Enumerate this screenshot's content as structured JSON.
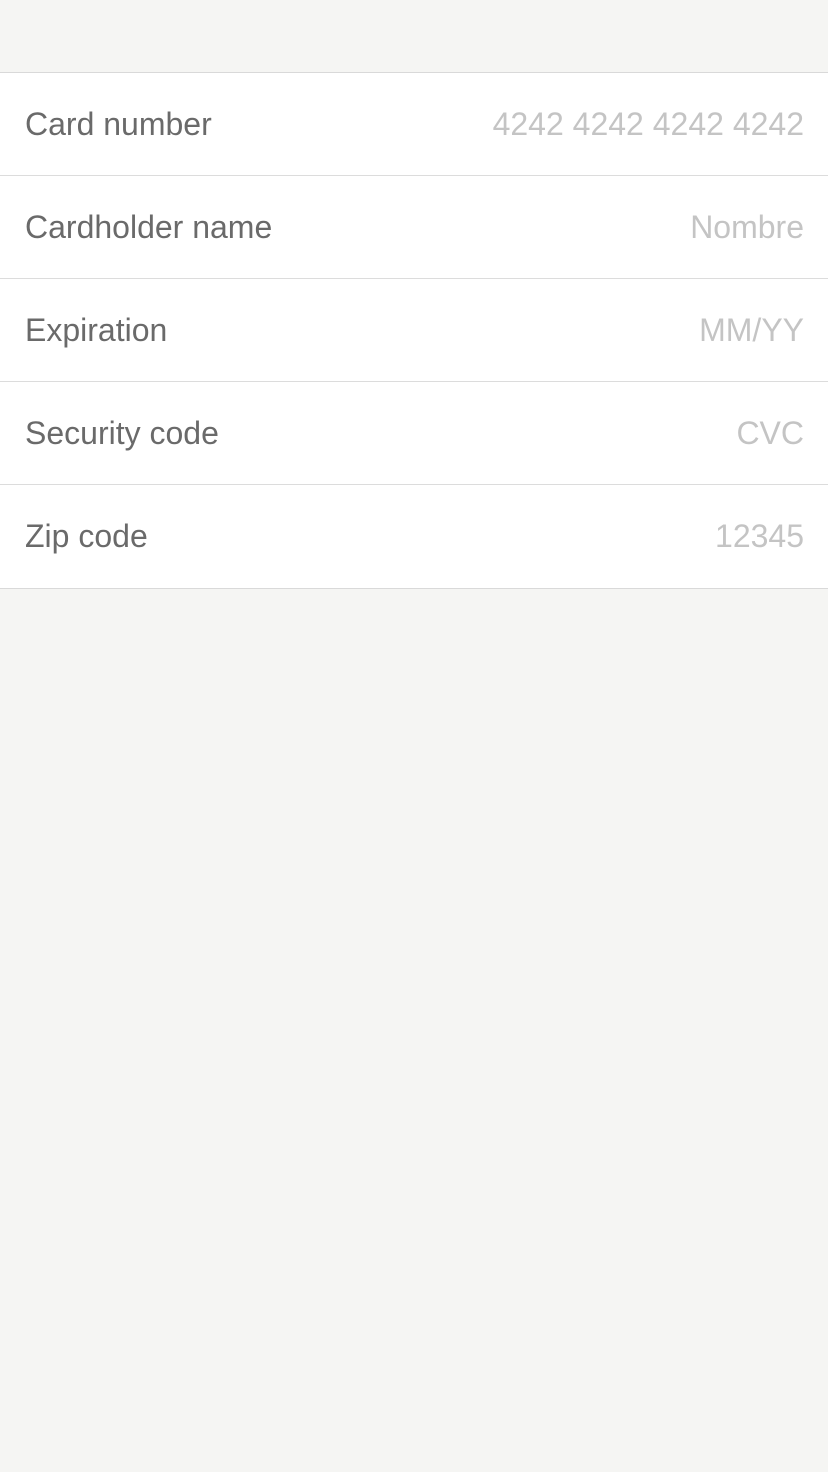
{
  "form": {
    "fields": [
      {
        "label": "Card number",
        "placeholder": "4242 4242 4242 4242",
        "value": ""
      },
      {
        "label": "Cardholder name",
        "placeholder": "Nombre",
        "value": ""
      },
      {
        "label": "Expiration",
        "placeholder": "MM/YY",
        "value": ""
      },
      {
        "label": "Security code",
        "placeholder": "CVC",
        "value": ""
      },
      {
        "label": "Zip code",
        "placeholder": "12345",
        "value": ""
      }
    ]
  },
  "colors": {
    "background": "#f5f5f3",
    "row_background": "#ffffff",
    "label_text": "#6a6a6a",
    "placeholder_text": "#c4c4c4",
    "divider": "#dcdcdc"
  }
}
